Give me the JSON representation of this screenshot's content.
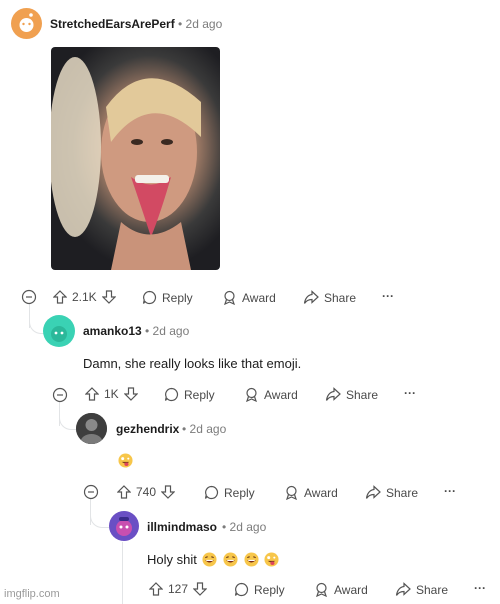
{
  "comments": [
    {
      "username": "StretchedEarsArePerf",
      "time": "2d ago",
      "score": "2.1K",
      "image_alt": "woman with tongue out"
    },
    {
      "username": "amanko13",
      "time": "2d ago",
      "body": "Damn, she really looks like that emoji.",
      "score": "1K"
    },
    {
      "username": "gezhendrix",
      "time": "2d ago",
      "body_emoji": "zany-face",
      "score": "740"
    },
    {
      "username": "illmindmaso",
      "time": "2d ago",
      "body": "Holy shit",
      "score": "127"
    }
  ],
  "actions": {
    "reply": "Reply",
    "award": "Award",
    "share": "Share",
    "more": "···",
    "separator": "•"
  },
  "watermark": "imgflip.com",
  "colors": {
    "avatar1": "#f0a050",
    "avatar2": "#3ad2b4",
    "avatar3": "#5a5a5a",
    "avatar4": "#6a4fc4",
    "emoji_face": "#f7c64a",
    "emoji_tongue": "#e0455b"
  }
}
